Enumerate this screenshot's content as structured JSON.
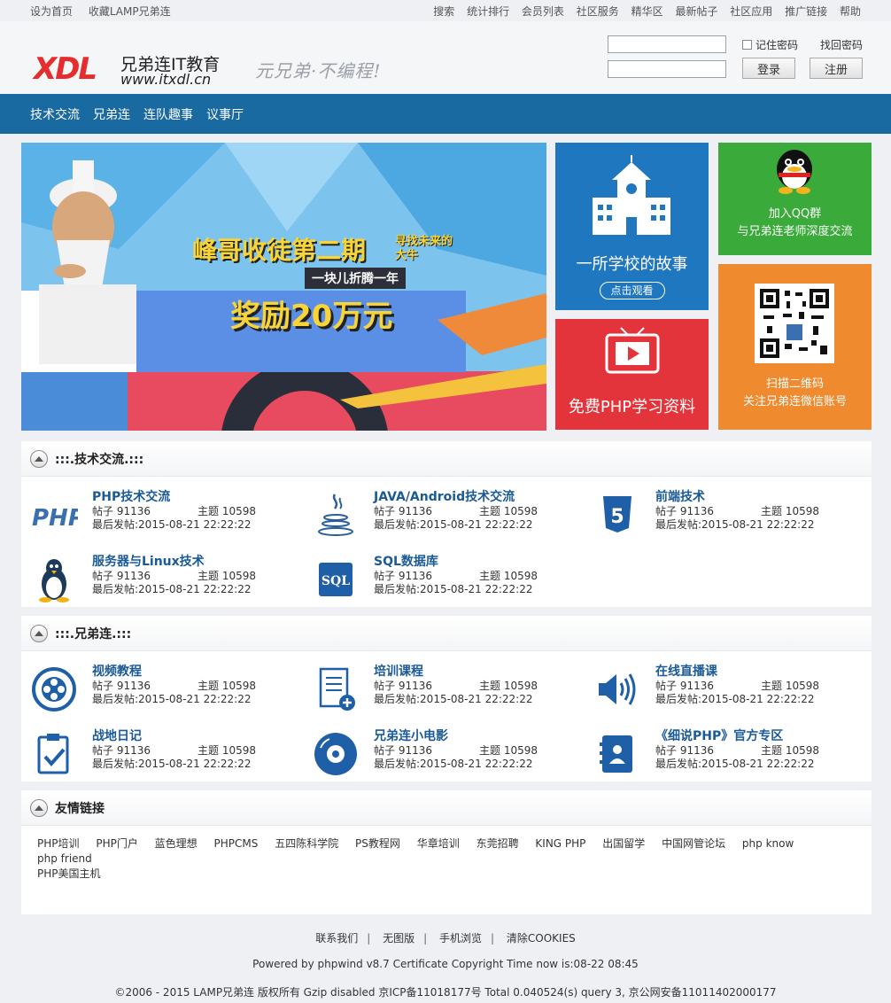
{
  "topbar": {
    "left": [
      "设为首页",
      "收藏LAMP兄弟连"
    ],
    "right": [
      "搜索",
      "统计排行",
      "会员列表",
      "社区服务",
      "精华区",
      "最新帖子",
      "社区应用",
      "推广链接",
      "帮助"
    ]
  },
  "header": {
    "logo_mark": "XDL",
    "logo_name": "兄弟连IT教育",
    "logo_url": "www.itxdl.cn",
    "slogan": "元兄弟·不编程!",
    "remember_label": "记住密码",
    "find_password": "找回密码",
    "login_button": "登录",
    "register_button": "注册"
  },
  "nav": [
    "技术交流",
    "兄弟连",
    "连队趣事",
    "议事厅"
  ],
  "banner": {
    "headline": "峰哥收徒第二期",
    "tag": "寻找未来的大牛",
    "ribbon": "一块儿折腾一年",
    "reward": "奖励20万元"
  },
  "tiles": {
    "school_title": "一所学校的故事",
    "school_button": "点击观看",
    "php_title": "免费PHP学习资料",
    "qq_line1": "加入QQ群",
    "qq_line2": "与兄弟连老师深度交流",
    "qr_line1": "扫描二维码",
    "qr_line2": "关注兄弟连微信账号"
  },
  "sections": [
    {
      "title": ":::.技术交流.:::",
      "forums": [
        {
          "name": "PHP技术交流",
          "icon": "php-icon",
          "posts": "帖子 91136",
          "topics": "主题 10598",
          "last": "最后发帖:2015-08-21 22:22:22"
        },
        {
          "name": "JAVA/Android技术交流",
          "icon": "java-icon",
          "posts": "帖子 91136",
          "topics": "主题 10598",
          "last": "最后发帖:2015-08-21 22:22:22"
        },
        {
          "name": "前端技术",
          "icon": "html5-icon",
          "posts": "帖子 91136",
          "topics": "主题 10598",
          "last": "最后发帖:2015-08-21 22:22:22"
        },
        {
          "name": "服务器与Linux技术",
          "icon": "linux-icon",
          "posts": "帖子 91136",
          "topics": "主题 10598",
          "last": "最后发帖:2015-08-21 22:22:22"
        },
        {
          "name": "SQL数据库",
          "icon": "sql-icon",
          "posts": "帖子 91136",
          "topics": "主题 10598",
          "last": "最后发帖:2015-08-21 22:22:22"
        }
      ]
    },
    {
      "title": ":::.兄弟连.:::",
      "forums": [
        {
          "name": "视频教程",
          "icon": "film-reel-icon",
          "posts": "帖子 91136",
          "topics": "主题 10598",
          "last": "最后发帖:2015-08-21 22:22:22"
        },
        {
          "name": "培训课程",
          "icon": "document-add-icon",
          "posts": "帖子 91136",
          "topics": "主题 10598",
          "last": "最后发帖:2015-08-21 22:22:22"
        },
        {
          "name": "在线直播课",
          "icon": "speaker-icon",
          "posts": "帖子 91136",
          "topics": "主题 10598",
          "last": "最后发帖:2015-08-21 22:22:22"
        },
        {
          "name": "战地日记",
          "icon": "clipboard-check-icon",
          "posts": "帖子 91136",
          "topics": "主题 10598",
          "last": "最后发帖:2015-08-21 22:22:22"
        },
        {
          "name": "兄弟连小电影",
          "icon": "disc-icon",
          "posts": "帖子 91136",
          "topics": "主题 10598",
          "last": "最后发帖:2015-08-21 22:22:22"
        },
        {
          "name": "《细说PHP》官方专区",
          "icon": "contact-book-icon",
          "posts": "帖子 91136",
          "topics": "主题 10598",
          "last": "最后发帖:2015-08-21 22:22:22"
        }
      ]
    }
  ],
  "links_section": {
    "title": "友情链接",
    "items": [
      "PHP培训",
      "PHP门户",
      "蓝色理想",
      "PHPCMS",
      "五四陈科学院",
      "PS教程网",
      "华章培训",
      "东莞招聘",
      "KING PHP",
      "出国留学",
      "中国网管论坛",
      "php know",
      "php friend",
      "PHP美国主机"
    ]
  },
  "footer": {
    "links": [
      "联系我们",
      "无图版",
      "手机浏览",
      "清除COOKIES"
    ],
    "powered": "Powered by phpwind v8.7 Certificate Copyright Time now is:08-22 08:45",
    "copyright": "©2006 - 2015 LAMP兄弟连 版权所有 Gzip disabled 京ICP备11018177号 Total 0.040524(s) query 3, 京公网安备11011402000177"
  },
  "colors": {
    "nav": "#1a6aa2",
    "forum_title": "#1a5a96",
    "tile_blue": "#1f77c0",
    "tile_green": "#3aab3a",
    "tile_red": "#e2343a",
    "tile_orange": "#ef8a2e"
  }
}
